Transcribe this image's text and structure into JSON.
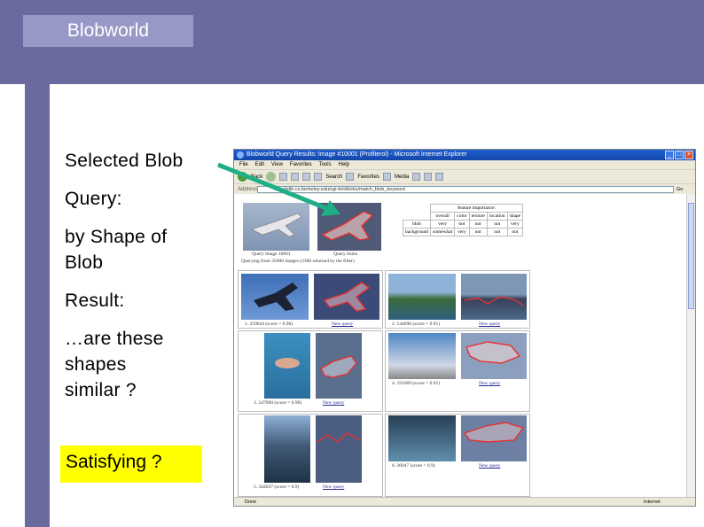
{
  "slide": {
    "title": "Blobworld",
    "body_lines": [
      "Selected Blob",
      "Query:",
      "by Shape of",
      "Blob",
      "Result:",
      "…are these",
      "shapes",
      "similar ?"
    ],
    "highlight": "Satisfying ?",
    "colors": {
      "accent": "#6a6a9e",
      "title_box": "#9898c6",
      "highlight": "#ffff00",
      "arrow": "#1fae86"
    }
  },
  "browser": {
    "window_title": "Blobworld Query Results: Image #10001 (Profiterol) - Microsoft Internet Explorer",
    "menu": [
      "File",
      "Edit",
      "View",
      "Favorites",
      "Tools",
      "Help"
    ],
    "toolbar": {
      "back": "Back",
      "search": "Search",
      "favorites": "Favorites",
      "media": "Media"
    },
    "address_label": "Address",
    "address": "http://elib.cs.berkeley.edu/cgi-bin/blobs/match_blob_keyword",
    "go": "Go",
    "status_left": "Done",
    "status_zone": "Internet"
  },
  "query": {
    "query_image_caption": "Query image 10001",
    "query_blobs_caption": "Query blobs",
    "querying_text": "Querying from 35000 images (2300 returned by the filter)"
  },
  "feature_table": {
    "header": "feature importance:",
    "columns": [
      "overall",
      "color",
      "texture",
      "location",
      "shape"
    ],
    "rows": [
      {
        "label": "blob",
        "values": [
          "very",
          "not",
          "not",
          "not",
          "very"
        ]
      },
      {
        "label": "background",
        "values": [
          "somewhat",
          "very",
          "not",
          "not",
          "not"
        ]
      }
    ]
  },
  "results": {
    "new_query_label": "New query",
    "captions": [
      "1. 359644 (score = 0.98)",
      "2. 144096 (score = 0.91)",
      "3. 247090 (score = 0.98)",
      "4. 191069 (score = 0.91)",
      "5. 344037 (score = 0.9)",
      "6. 26047 (score = 0.9)"
    ]
  }
}
